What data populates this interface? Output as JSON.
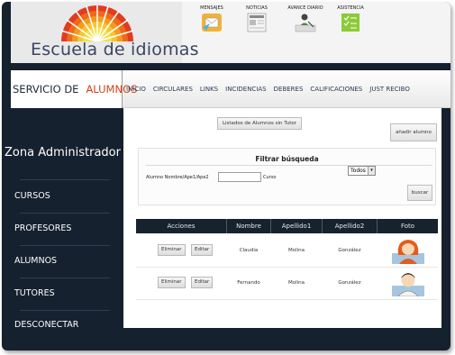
{
  "header": {
    "logo_text": "Escuela de idiomas",
    "icons": [
      {
        "label": "MENSAJES",
        "icon": "envelope-icon"
      },
      {
        "label": "NOTICIAS",
        "icon": "newspaper-icon"
      },
      {
        "label": "AVANCE DIARIO",
        "icon": "writing-person-icon"
      },
      {
        "label": "ASISTENCIA",
        "icon": "checklist-icon"
      }
    ]
  },
  "nav": {
    "title_part1": "SERVICIO DE",
    "title_part2": "ALUMNOS",
    "links": [
      "INICIO",
      "CIRCULARES",
      "LINKS",
      "INCIDENCIAS",
      "DEBERES",
      "CALIFICACIONES",
      "JUST RECIBO"
    ]
  },
  "sidebar": {
    "zone_title": "Zona Administrador",
    "items": [
      "CURSOS",
      "PROFESORES",
      "ALUMNOS",
      "TUTORES",
      "DESCONECTAR"
    ]
  },
  "main": {
    "list_tutor_button": "Listados de Alumnos sin Tutor",
    "add_student_button": "añadir alumno",
    "filter": {
      "title": "Filtrar búsqueda",
      "name_label": "Alumno Nombre/Ape1/Ape2",
      "name_value": "",
      "course_label": "Curso",
      "course_selected": "Todos",
      "search_button": "buscar"
    },
    "table": {
      "headers": [
        "Acciones",
        "Nombre",
        "Apellido1",
        "Apellido2",
        "Foto"
      ],
      "delete_label": "Eliminar",
      "edit_label": "Editar",
      "rows": [
        {
          "nombre": "Claudia",
          "apellido1": "Molina",
          "apellido2": "González",
          "foto": "female-avatar-icon"
        },
        {
          "nombre": "Fernando",
          "apellido1": "Molina",
          "apellido2": "González",
          "foto": "male-avatar-icon"
        }
      ]
    }
  },
  "colors": {
    "sidebar_bg": "#15212e",
    "accent_red": "#d3401a",
    "link_blue": "#2d3b53",
    "table_header": "#16222e"
  }
}
